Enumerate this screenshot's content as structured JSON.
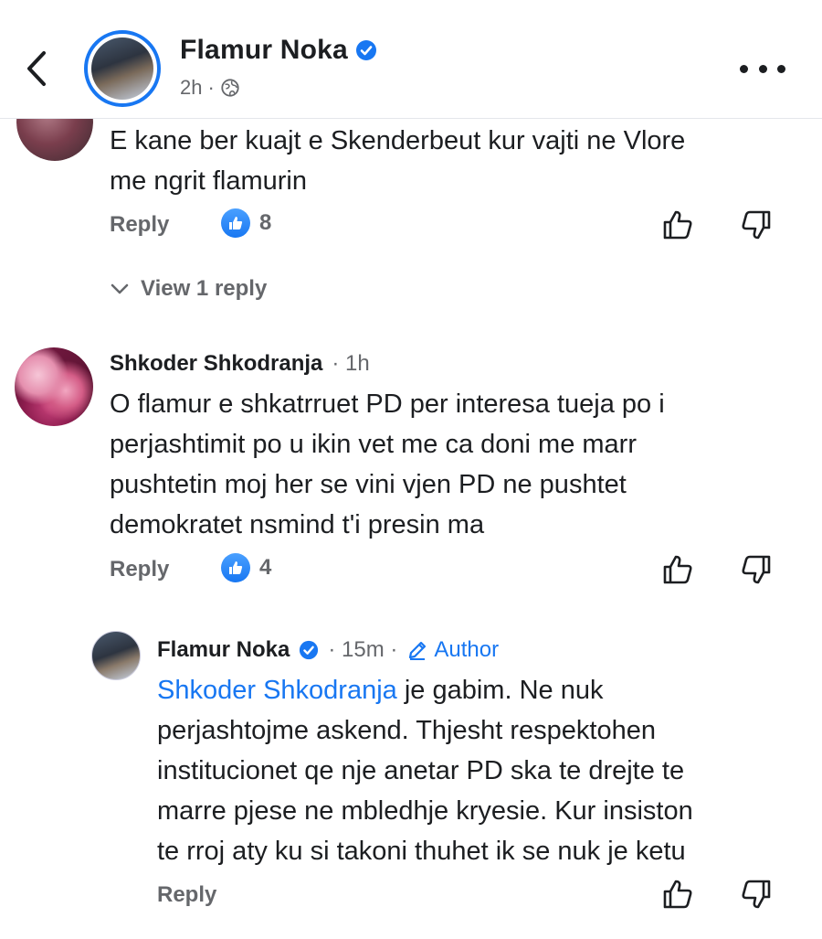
{
  "header": {
    "name": "Flamur Noka",
    "time": "2h",
    "dot": "·"
  },
  "comments": [
    {
      "text_line1": "E kane ber  kuajt e Skenderbeut kur vajti ne Vlore",
      "text_line2": "me ngrit flamurin",
      "reply_label": "Reply",
      "likes": "8",
      "view_replies": "View 1 reply"
    },
    {
      "author": "Shkoder Shkodranja",
      "time": "· 1h",
      "lines": [
        "O flamur e shkatrruet PD per interesa tueja po i",
        "perjashtimit po u ikin vet me ca doni me marr",
        "pushtetin moj her  se vini vjen PD ne pushtet",
        "demokratet nsmind t'i presin ma"
      ],
      "reply_label": "Reply",
      "likes": "4"
    },
    {
      "author": "Flamur Noka",
      "time": "· 15m ·",
      "author_badge": "Author",
      "mention": "Shkoder Shkodranja",
      "first_line_rest": " je gabim.  Ne nuk",
      "lines": [
        "perjashtojme askend.   Thjesht respektohen",
        "institucionet qe nje anetar PD ska te drejte te",
        "marre pjese ne mbledhje kryesie.   Kur insiston",
        "te rroj aty ku si takoni thuhet ik se nuk je ketu"
      ],
      "reply_label": "Reply"
    }
  ],
  "colors": {
    "accent": "#1877f2",
    "muted": "#65676b",
    "text": "#1c1e21"
  },
  "icons": [
    "back-icon",
    "verified-icon",
    "globe-icon",
    "more-icon",
    "like-badge-icon",
    "thumbs-up-icon",
    "thumbs-down-icon",
    "chevron-down-icon",
    "pencil-icon"
  ]
}
